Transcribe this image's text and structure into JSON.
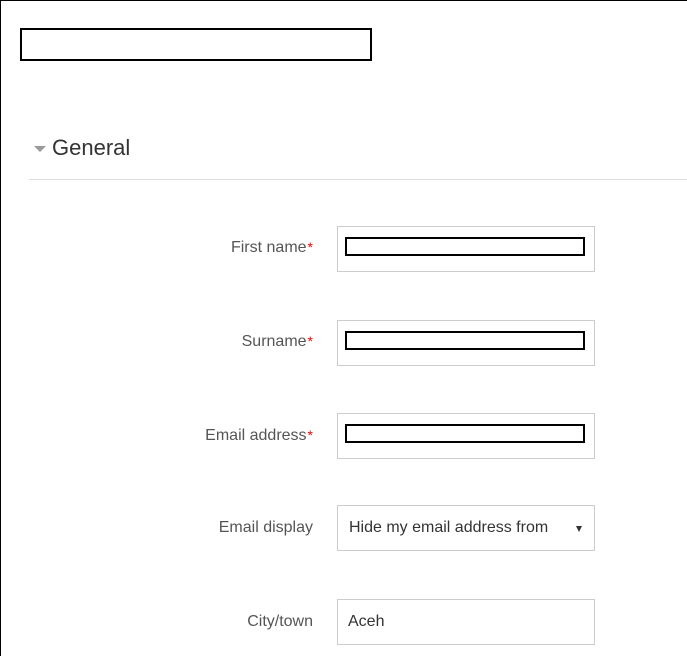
{
  "section": {
    "title": "General"
  },
  "fields": {
    "first_name": {
      "label": "First name",
      "required_marker": "*"
    },
    "surname": {
      "label": "Surname",
      "required_marker": "*"
    },
    "email": {
      "label": "Email address",
      "required_marker": "*"
    },
    "email_display": {
      "label": "Email display",
      "selected": "Hide my email address from"
    },
    "city": {
      "label": "City/town",
      "value": "Aceh"
    }
  },
  "colors": {
    "required": "#ef0000",
    "label": "#555555",
    "border": "#cccccc"
  },
  "icons": {
    "section_toggle": "caret-down-icon",
    "select_arrow": "dropdown-arrow-icon"
  }
}
